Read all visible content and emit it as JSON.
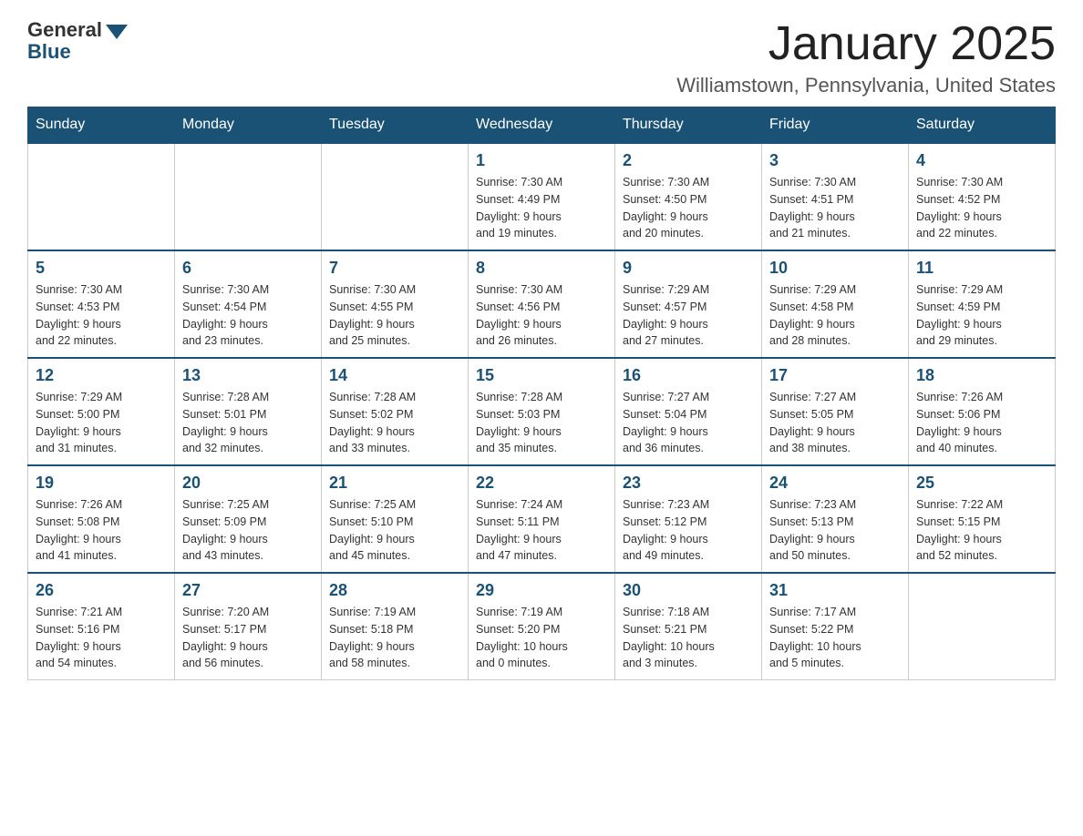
{
  "header": {
    "logo_general": "General",
    "logo_blue": "Blue",
    "month_title": "January 2025",
    "location": "Williamstown, Pennsylvania, United States"
  },
  "weekdays": [
    "Sunday",
    "Monday",
    "Tuesday",
    "Wednesday",
    "Thursday",
    "Friday",
    "Saturday"
  ],
  "weeks": [
    [
      {
        "day": "",
        "info": ""
      },
      {
        "day": "",
        "info": ""
      },
      {
        "day": "",
        "info": ""
      },
      {
        "day": "1",
        "info": "Sunrise: 7:30 AM\nSunset: 4:49 PM\nDaylight: 9 hours\nand 19 minutes."
      },
      {
        "day": "2",
        "info": "Sunrise: 7:30 AM\nSunset: 4:50 PM\nDaylight: 9 hours\nand 20 minutes."
      },
      {
        "day": "3",
        "info": "Sunrise: 7:30 AM\nSunset: 4:51 PM\nDaylight: 9 hours\nand 21 minutes."
      },
      {
        "day": "4",
        "info": "Sunrise: 7:30 AM\nSunset: 4:52 PM\nDaylight: 9 hours\nand 22 minutes."
      }
    ],
    [
      {
        "day": "5",
        "info": "Sunrise: 7:30 AM\nSunset: 4:53 PM\nDaylight: 9 hours\nand 22 minutes."
      },
      {
        "day": "6",
        "info": "Sunrise: 7:30 AM\nSunset: 4:54 PM\nDaylight: 9 hours\nand 23 minutes."
      },
      {
        "day": "7",
        "info": "Sunrise: 7:30 AM\nSunset: 4:55 PM\nDaylight: 9 hours\nand 25 minutes."
      },
      {
        "day": "8",
        "info": "Sunrise: 7:30 AM\nSunset: 4:56 PM\nDaylight: 9 hours\nand 26 minutes."
      },
      {
        "day": "9",
        "info": "Sunrise: 7:29 AM\nSunset: 4:57 PM\nDaylight: 9 hours\nand 27 minutes."
      },
      {
        "day": "10",
        "info": "Sunrise: 7:29 AM\nSunset: 4:58 PM\nDaylight: 9 hours\nand 28 minutes."
      },
      {
        "day": "11",
        "info": "Sunrise: 7:29 AM\nSunset: 4:59 PM\nDaylight: 9 hours\nand 29 minutes."
      }
    ],
    [
      {
        "day": "12",
        "info": "Sunrise: 7:29 AM\nSunset: 5:00 PM\nDaylight: 9 hours\nand 31 minutes."
      },
      {
        "day": "13",
        "info": "Sunrise: 7:28 AM\nSunset: 5:01 PM\nDaylight: 9 hours\nand 32 minutes."
      },
      {
        "day": "14",
        "info": "Sunrise: 7:28 AM\nSunset: 5:02 PM\nDaylight: 9 hours\nand 33 minutes."
      },
      {
        "day": "15",
        "info": "Sunrise: 7:28 AM\nSunset: 5:03 PM\nDaylight: 9 hours\nand 35 minutes."
      },
      {
        "day": "16",
        "info": "Sunrise: 7:27 AM\nSunset: 5:04 PM\nDaylight: 9 hours\nand 36 minutes."
      },
      {
        "day": "17",
        "info": "Sunrise: 7:27 AM\nSunset: 5:05 PM\nDaylight: 9 hours\nand 38 minutes."
      },
      {
        "day": "18",
        "info": "Sunrise: 7:26 AM\nSunset: 5:06 PM\nDaylight: 9 hours\nand 40 minutes."
      }
    ],
    [
      {
        "day": "19",
        "info": "Sunrise: 7:26 AM\nSunset: 5:08 PM\nDaylight: 9 hours\nand 41 minutes."
      },
      {
        "day": "20",
        "info": "Sunrise: 7:25 AM\nSunset: 5:09 PM\nDaylight: 9 hours\nand 43 minutes."
      },
      {
        "day": "21",
        "info": "Sunrise: 7:25 AM\nSunset: 5:10 PM\nDaylight: 9 hours\nand 45 minutes."
      },
      {
        "day": "22",
        "info": "Sunrise: 7:24 AM\nSunset: 5:11 PM\nDaylight: 9 hours\nand 47 minutes."
      },
      {
        "day": "23",
        "info": "Sunrise: 7:23 AM\nSunset: 5:12 PM\nDaylight: 9 hours\nand 49 minutes."
      },
      {
        "day": "24",
        "info": "Sunrise: 7:23 AM\nSunset: 5:13 PM\nDaylight: 9 hours\nand 50 minutes."
      },
      {
        "day": "25",
        "info": "Sunrise: 7:22 AM\nSunset: 5:15 PM\nDaylight: 9 hours\nand 52 minutes."
      }
    ],
    [
      {
        "day": "26",
        "info": "Sunrise: 7:21 AM\nSunset: 5:16 PM\nDaylight: 9 hours\nand 54 minutes."
      },
      {
        "day": "27",
        "info": "Sunrise: 7:20 AM\nSunset: 5:17 PM\nDaylight: 9 hours\nand 56 minutes."
      },
      {
        "day": "28",
        "info": "Sunrise: 7:19 AM\nSunset: 5:18 PM\nDaylight: 9 hours\nand 58 minutes."
      },
      {
        "day": "29",
        "info": "Sunrise: 7:19 AM\nSunset: 5:20 PM\nDaylight: 10 hours\nand 0 minutes."
      },
      {
        "day": "30",
        "info": "Sunrise: 7:18 AM\nSunset: 5:21 PM\nDaylight: 10 hours\nand 3 minutes."
      },
      {
        "day": "31",
        "info": "Sunrise: 7:17 AM\nSunset: 5:22 PM\nDaylight: 10 hours\nand 5 minutes."
      },
      {
        "day": "",
        "info": ""
      }
    ]
  ]
}
